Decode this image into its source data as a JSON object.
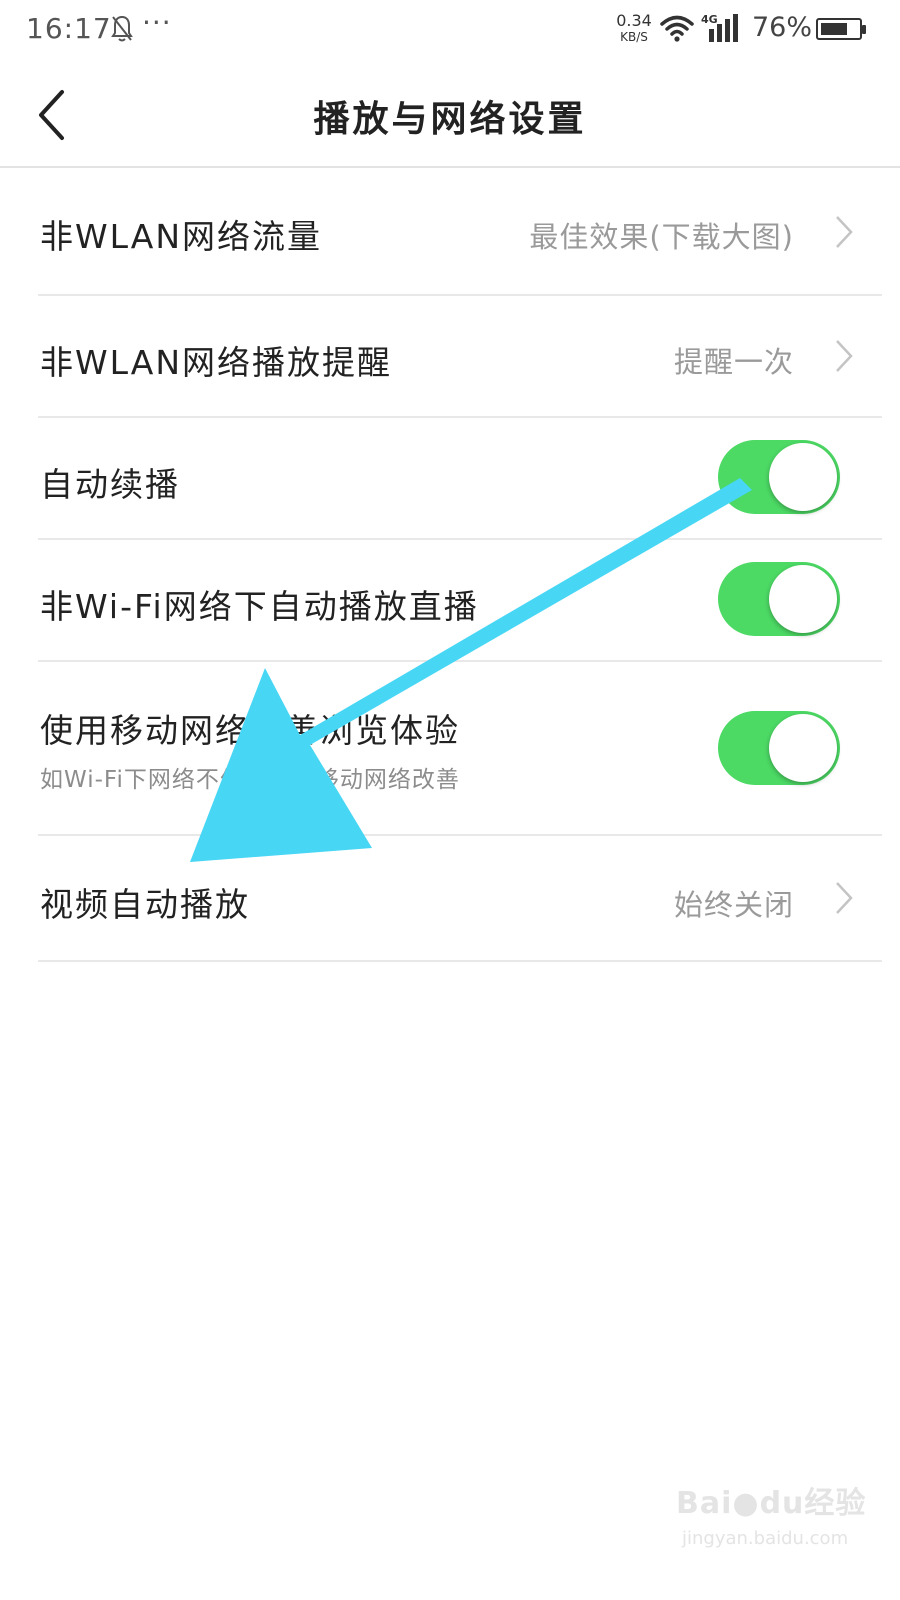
{
  "status_bar": {
    "time": "16:17",
    "more": "···",
    "speed_value": "0.34",
    "speed_unit": "KB/S",
    "network_type": "4G",
    "battery_percent": "76%",
    "battery_level": 0.76,
    "icons": [
      "bell-muted-icon",
      "wifi-icon",
      "signal-icon",
      "battery-icon"
    ]
  },
  "header": {
    "title": "播放与网络设置",
    "back_icon": "chevron-left-icon"
  },
  "settings": {
    "row1": {
      "label": "非WLAN网络流量",
      "value": "最佳效果(下载大图)"
    },
    "row2": {
      "label": "非WLAN网络播放提醒",
      "value": "提醒一次"
    },
    "row3": {
      "label": "自动续播",
      "toggle_on": true
    },
    "row4": {
      "label": "非Wi-Fi网络下自动播放直播",
      "toggle_on": true
    },
    "row5": {
      "label": "使用移动网络改善浏览体验",
      "subtitle": "如Wi-Fi下网络不佳时使用移动网络改善",
      "toggle_on": true
    },
    "row6": {
      "label": "视频自动播放",
      "value": "始终关闭"
    }
  },
  "colors": {
    "toggle_on": "#4cd964",
    "annotation_arrow": "#48d6f5"
  },
  "watermark": {
    "brand": "Bai●du经验",
    "site": "jingyan.baidu.com"
  }
}
